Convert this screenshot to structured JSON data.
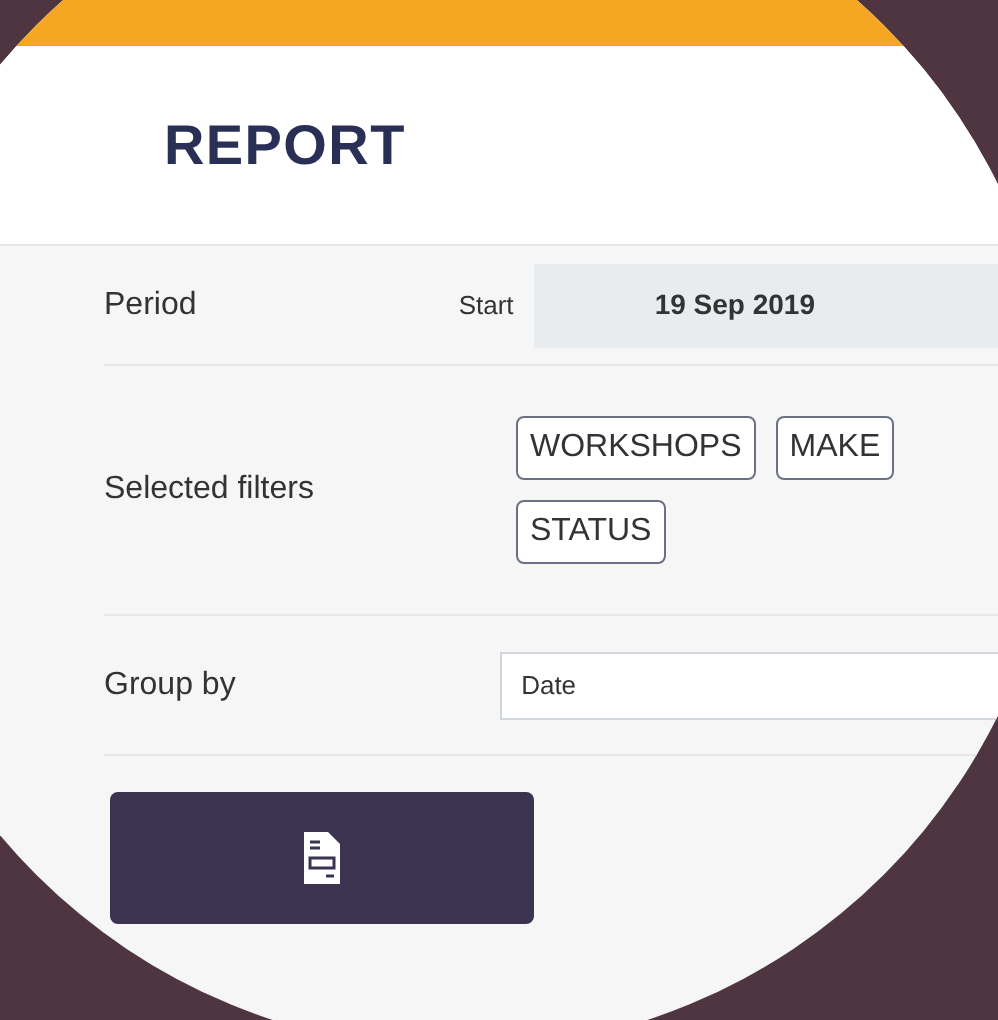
{
  "title": "REPORT",
  "period": {
    "label": "Period",
    "start_label": "Start",
    "start_value": "19 Sep 2019"
  },
  "filters": {
    "label": "Selected filters",
    "tags": [
      "WORKSHOPS",
      "MAKE",
      "STATUS"
    ]
  },
  "group_by": {
    "label": "Group by",
    "value": "Date"
  }
}
